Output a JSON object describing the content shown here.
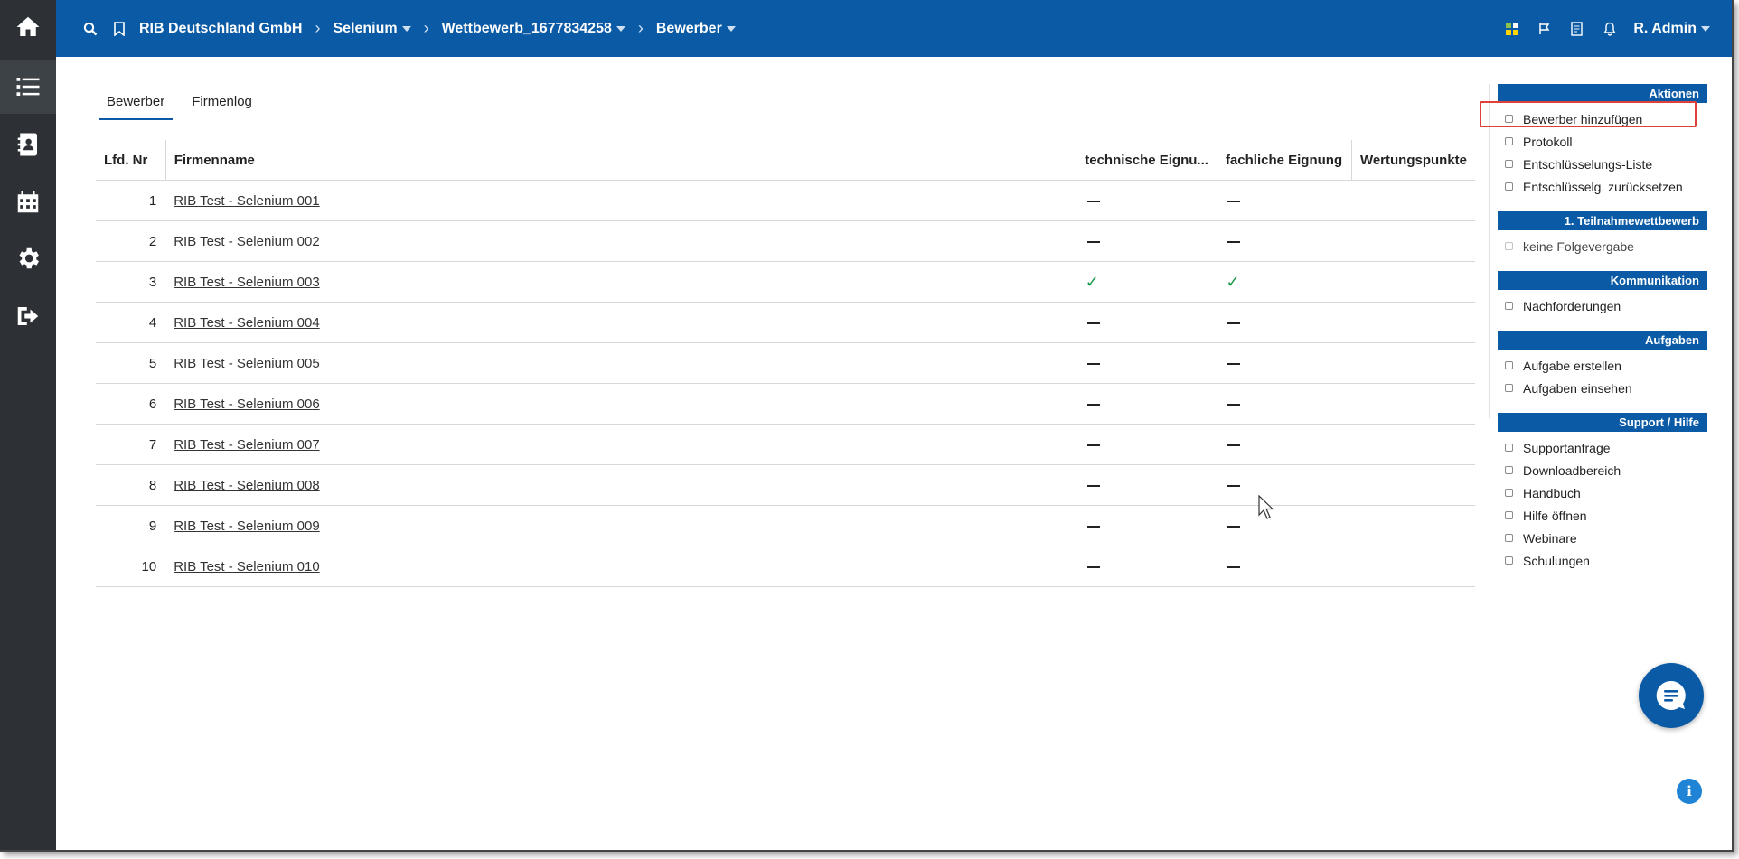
{
  "topbar": {
    "breadcrumbs": [
      {
        "label": "RIB Deutschland GmbH",
        "dropdown": false
      },
      {
        "label": "Selenium",
        "dropdown": true
      },
      {
        "label": "Wettbewerb_1677834258",
        "dropdown": true
      },
      {
        "label": "Bewerber",
        "dropdown": true
      }
    ],
    "user": "R. Admin"
  },
  "tabs": [
    {
      "label": "Bewerber",
      "active": true
    },
    {
      "label": "Firmenlog",
      "active": false
    }
  ],
  "table": {
    "headers": [
      "Lfd. Nr",
      "Firmenname",
      "technische Eignu...",
      "fachliche Eignung",
      "Wertungspunkte"
    ],
    "rows": [
      {
        "nr": "1",
        "name": "RIB Test - Selenium 001",
        "tech": "dash",
        "fach": "dash"
      },
      {
        "nr": "2",
        "name": "RIB Test - Selenium 002",
        "tech": "dash",
        "fach": "dash"
      },
      {
        "nr": "3",
        "name": "RIB Test - Selenium 003",
        "tech": "check",
        "fach": "check"
      },
      {
        "nr": "4",
        "name": "RIB Test - Selenium 004",
        "tech": "dash",
        "fach": "dash"
      },
      {
        "nr": "5",
        "name": "RIB Test - Selenium 005",
        "tech": "dash",
        "fach": "dash"
      },
      {
        "nr": "6",
        "name": "RIB Test - Selenium 006",
        "tech": "dash",
        "fach": "dash"
      },
      {
        "nr": "7",
        "name": "RIB Test - Selenium 007",
        "tech": "dash",
        "fach": "dash"
      },
      {
        "nr": "8",
        "name": "RIB Test - Selenium 008",
        "tech": "dash",
        "fach": "dash"
      },
      {
        "nr": "9",
        "name": "RIB Test - Selenium 009",
        "tech": "dash",
        "fach": "dash"
      },
      {
        "nr": "10",
        "name": "RIB Test - Selenium 010",
        "tech": "dash",
        "fach": "dash"
      }
    ]
  },
  "panel": {
    "sections": [
      {
        "title": "Aktionen",
        "items": [
          "Bewerber hinzufügen",
          "Protokoll",
          "Entschlüsselungs-Liste",
          "Entschlüsselg. zurücksetzen"
        ]
      },
      {
        "title": "1. Teilnahmewettbewerb",
        "items": [
          "keine Folgevergabe"
        ]
      },
      {
        "title": "Kommunikation",
        "items": [
          "Nachforderungen"
        ]
      },
      {
        "title": "Aufgaben",
        "items": [
          "Aufgabe erstellen",
          "Aufgaben einsehen"
        ]
      },
      {
        "title": "Support / Hilfe",
        "items": [
          "Supportanfrage",
          "Downloadbereich",
          "Handbuch",
          "Hilfe öffnen",
          "Webinare",
          "Schulungen"
        ]
      }
    ]
  },
  "colors": {
    "brand_blue": "#0a5aa5",
    "rail_bg": "#2d3135",
    "check_green": "#1a9b4b",
    "highlight_red": "#e0403a"
  },
  "icons": {
    "rail": [
      "home-icon",
      "list-icon",
      "contacts-icon",
      "calendar-icon",
      "gear-icon",
      "logout-icon"
    ],
    "topbar": [
      "search-icon",
      "bookmark-icon",
      "apps-icon",
      "flag-icon",
      "notes-icon",
      "bell-icon"
    ]
  }
}
